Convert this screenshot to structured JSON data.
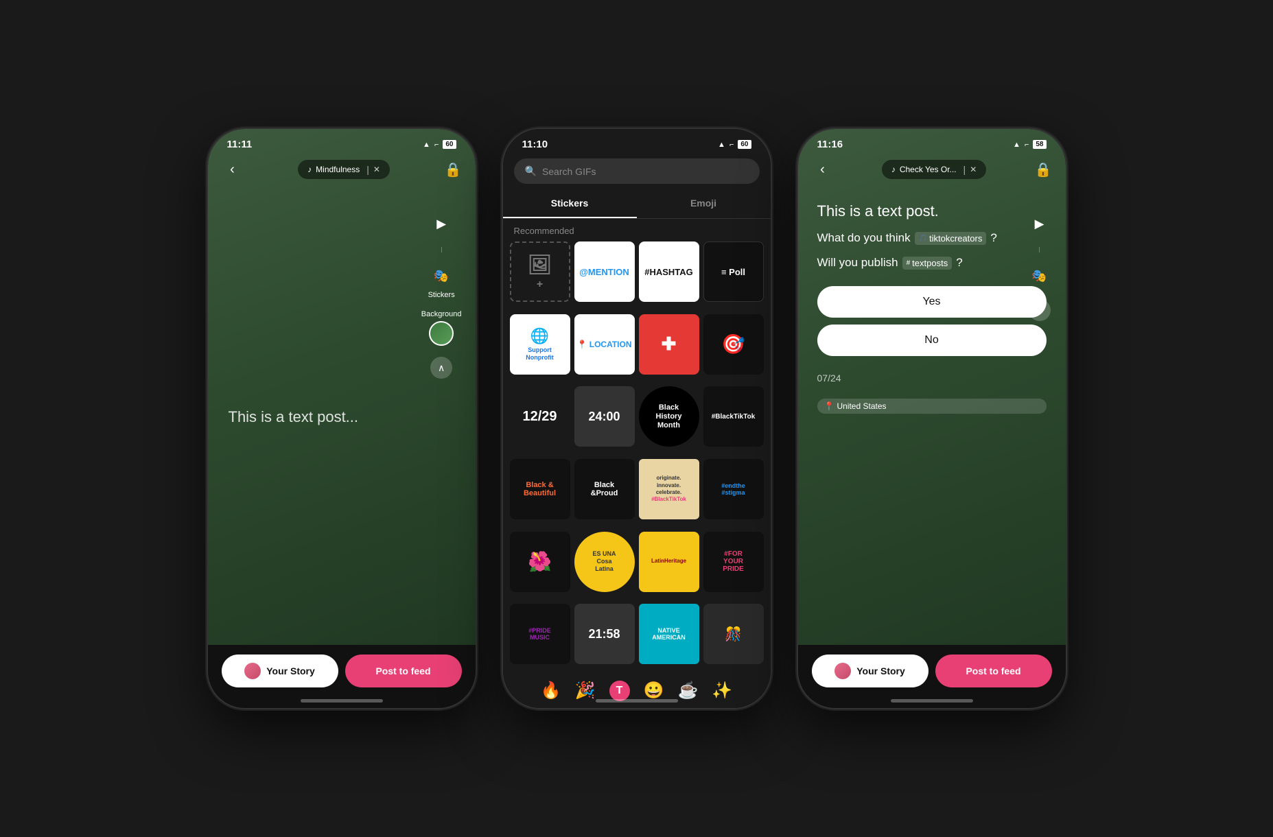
{
  "phones": {
    "phone1": {
      "status": {
        "time": "11:11",
        "signal": "●●●●",
        "wifi": "wifi",
        "battery": "60"
      },
      "music_pill": "Mindfulness",
      "tools": {
        "stickers_label": "Stickers",
        "background_label": "Background"
      },
      "canvas_text": "This is a text post...",
      "bottom": {
        "your_story": "Your Story",
        "post_to_feed": "Post to feed"
      }
    },
    "phone2": {
      "status": {
        "time": "11:10",
        "battery": "60"
      },
      "search_placeholder": "Search GIFs",
      "tabs": [
        "Stickers",
        "Emoji"
      ],
      "active_tab": "Stickers",
      "section_label": "Recommended",
      "stickers": {
        "row1": [
          "add",
          "mention",
          "hashtag",
          "poll"
        ],
        "row2": [
          "support_nonprofit",
          "location",
          "health",
          "poll_circle"
        ],
        "row3": [
          "date_1229",
          "clock_2400",
          "black_history_month",
          "blacktiktok"
        ],
        "row4": [
          "black_beautiful",
          "black_proud",
          "originate",
          "endthe_stigma"
        ],
        "row5": [
          "cosa_latina_1",
          "cosa_latina_2",
          "latin_heritage",
          "for_your_pride"
        ],
        "row6": [
          "pride_music",
          "time_2158",
          "native_american",
          "misc_pattern"
        ],
        "emoji_row": [
          "🔥",
          "🎉",
          "T",
          "😀",
          "☕",
          "✨"
        ]
      }
    },
    "phone3": {
      "status": {
        "time": "11:16",
        "battery": "58"
      },
      "music_pill": "Check Yes Or...",
      "canvas": {
        "line1": "This is a text post.",
        "line2_prefix": "What do you think",
        "mention1": "tiktokcreators",
        "line2_suffix": "?",
        "line3_prefix": "Will you publish",
        "mention2": "textposts",
        "line3_suffix": "?",
        "poll_yes": "Yes",
        "poll_no": "No",
        "date": "07/24",
        "location": "United States"
      },
      "bottom": {
        "your_story": "Your Story",
        "post_to_feed": "Post to feed"
      }
    }
  }
}
